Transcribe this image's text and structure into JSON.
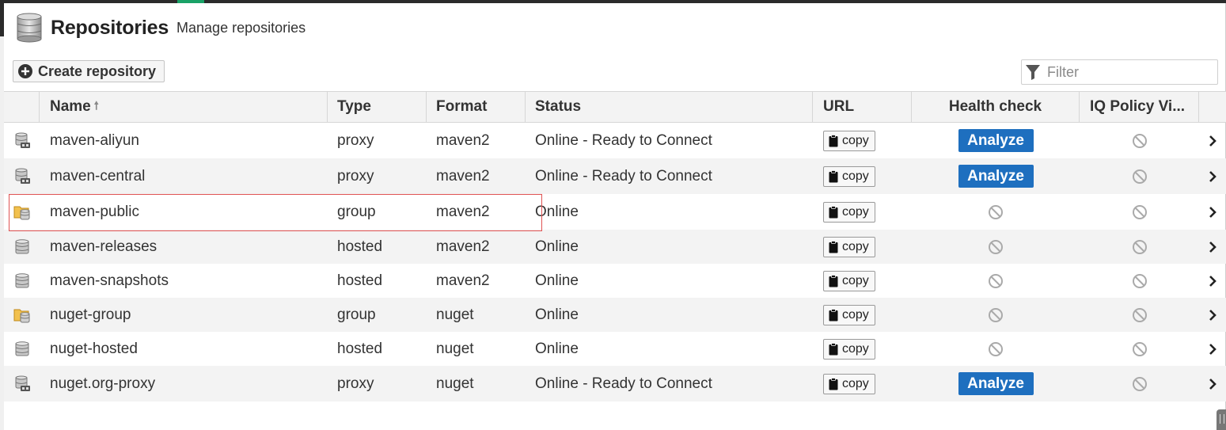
{
  "header": {
    "title": "Repositories",
    "subtitle": "Manage repositories",
    "icon": "database-icon"
  },
  "toolbar": {
    "create_label": "Create repository",
    "filter_placeholder": "Filter"
  },
  "columns": {
    "name": "Name",
    "type": "Type",
    "format": "Format",
    "status": "Status",
    "url": "URL",
    "health": "Health check",
    "iq": "IQ Policy Vi..."
  },
  "rows": [
    {
      "name": "maven-aliyun",
      "type": "proxy",
      "format": "maven2",
      "status": "Online - Ready to Connect",
      "copy": "copy",
      "analyze": "Analyze",
      "icon": "proxy-repo-icon"
    },
    {
      "name": "maven-central",
      "type": "proxy",
      "format": "maven2",
      "status": "Online - Ready to Connect",
      "copy": "copy",
      "analyze": "Analyze",
      "icon": "proxy-repo-icon"
    },
    {
      "name": "maven-public",
      "type": "group",
      "format": "maven2",
      "status": "Online",
      "copy": "copy",
      "analyze": "",
      "icon": "group-repo-icon"
    },
    {
      "name": "maven-releases",
      "type": "hosted",
      "format": "maven2",
      "status": "Online",
      "copy": "copy",
      "analyze": "",
      "icon": "hosted-repo-icon"
    },
    {
      "name": "maven-snapshots",
      "type": "hosted",
      "format": "maven2",
      "status": "Online",
      "copy": "copy",
      "analyze": "",
      "icon": "hosted-repo-icon"
    },
    {
      "name": "nuget-group",
      "type": "group",
      "format": "nuget",
      "status": "Online",
      "copy": "copy",
      "analyze": "",
      "icon": "group-repo-icon"
    },
    {
      "name": "nuget-hosted",
      "type": "hosted",
      "format": "nuget",
      "status": "Online",
      "copy": "copy",
      "analyze": "",
      "icon": "hosted-repo-icon"
    },
    {
      "name": "nuget.org-proxy",
      "type": "proxy",
      "format": "nuget",
      "status": "Online - Ready to Connect",
      "copy": "copy",
      "analyze": "Analyze",
      "icon": "proxy-repo-icon"
    }
  ],
  "colors": {
    "accent": "#1e6fbf",
    "highlight": "#e05353",
    "alt_row": "#f3f3f3"
  }
}
